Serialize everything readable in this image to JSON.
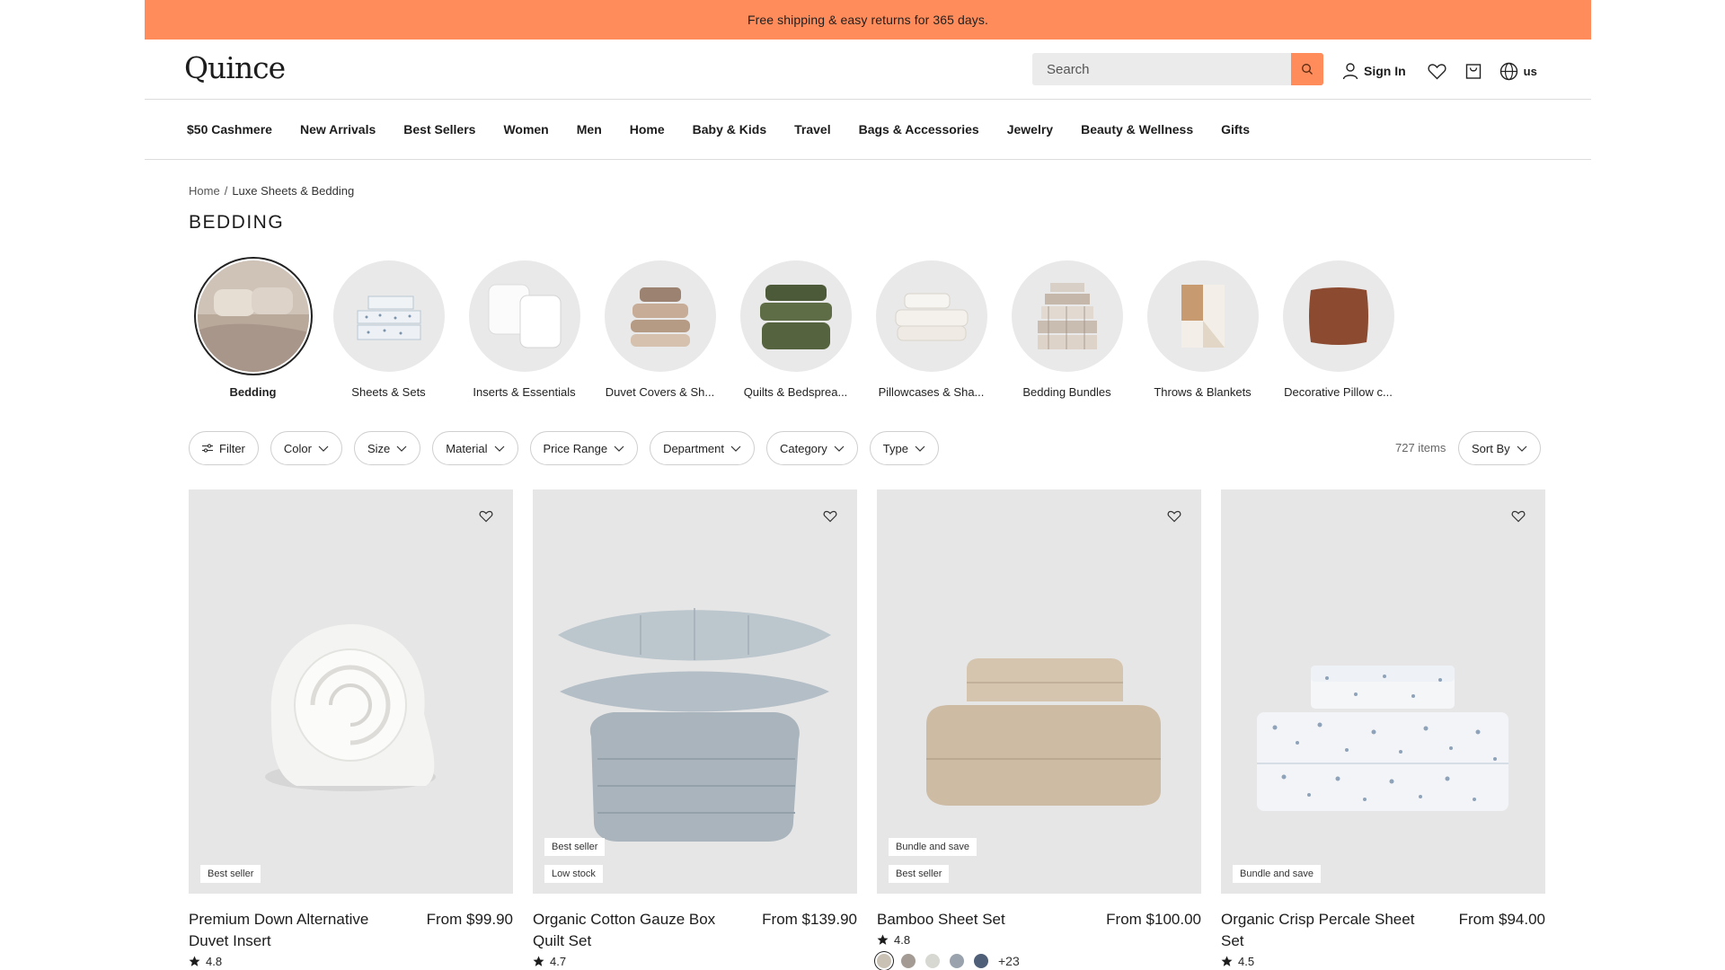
{
  "promo": {
    "text": "Free shipping & easy returns for 365 days."
  },
  "header": {
    "logo": "Quince",
    "search_placeholder": "Search",
    "sign_in": "Sign In",
    "locale": "us",
    "accent": "#ff8c5a"
  },
  "nav": [
    "$50 Cashmere",
    "New Arrivals",
    "Best Sellers",
    "Women",
    "Men",
    "Home",
    "Baby & Kids",
    "Travel",
    "Bags & Accessories",
    "Jewelry",
    "Beauty & Wellness",
    "Gifts"
  ],
  "breadcrumb": {
    "home": "Home",
    "separator": "/",
    "current": "Luxe Sheets & Bedding"
  },
  "page_title": "BEDDING",
  "categories": [
    {
      "label": "Bedding",
      "active": true
    },
    {
      "label": "Sheets & Sets"
    },
    {
      "label": "Inserts & Essentials"
    },
    {
      "label": "Duvet Covers & Sh..."
    },
    {
      "label": "Quilts & Bedsprea..."
    },
    {
      "label": "Pillowcases & Sha..."
    },
    {
      "label": "Bedding Bundles"
    },
    {
      "label": "Throws & Blankets"
    },
    {
      "label": "Decorative Pillow c..."
    }
  ],
  "filters": [
    "Filter",
    "Color",
    "Size",
    "Material",
    "Price Range",
    "Department",
    "Category",
    "Type"
  ],
  "item_count": "727 items",
  "sort_label": "Sort By",
  "products": [
    {
      "name": "Premium Down Alternative Duvet Insert",
      "price": "From $99.90",
      "rating": "4.8",
      "badges": [
        "Best seller"
      ]
    },
    {
      "name": "Organic Cotton Gauze Box Quilt Set",
      "price": "From $139.90",
      "rating": "4.7",
      "badges": [
        "Best seller",
        "Low stock"
      ]
    },
    {
      "name": "Bamboo Sheet Set",
      "price": "From $100.00",
      "rating": "4.8",
      "badges": [
        "Bundle and save",
        "Best seller"
      ],
      "swatches": [
        "#c9c2b4",
        "#a49c94",
        "#d8d8d2",
        "#9aa3ad",
        "#4f5f78"
      ],
      "more_colors": "+23"
    },
    {
      "name": "Organic Crisp Percale Sheet Set",
      "price": "From $94.00",
      "rating": "4.5",
      "badges": [
        "Bundle and save"
      ]
    }
  ]
}
